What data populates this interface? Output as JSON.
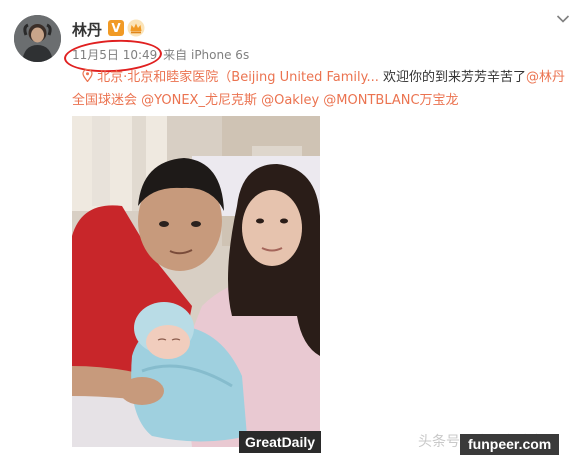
{
  "post": {
    "username": "林丹",
    "verified_badge": "V",
    "timestamp": "11月5日 10:49",
    "source_prefix": "来自",
    "source_device": "iPhone 6s",
    "location_text": "北京·北京和睦家医院（Beijing United Family...",
    "message": " 欢迎你的到来芳芳辛苦了",
    "mentions": [
      "@林丹全国球迷会",
      "@YONEX_尤尼克斯",
      "@Oakley",
      "@MONTBLANC万宝龙"
    ],
    "icons": {
      "location": "location-pin-icon",
      "more": "chevron-down-icon",
      "verified": "verified-v-icon",
      "vip": "vip-crown-icon"
    },
    "colors": {
      "link": "#eb7350",
      "meta": "#808080",
      "annotation_circle": "#e02020"
    }
  },
  "watermarks": {
    "greatdaily": "GreatDaily",
    "toutiao": "头条号 / 体坛实验室",
    "funpeer": "funpeer.com"
  }
}
